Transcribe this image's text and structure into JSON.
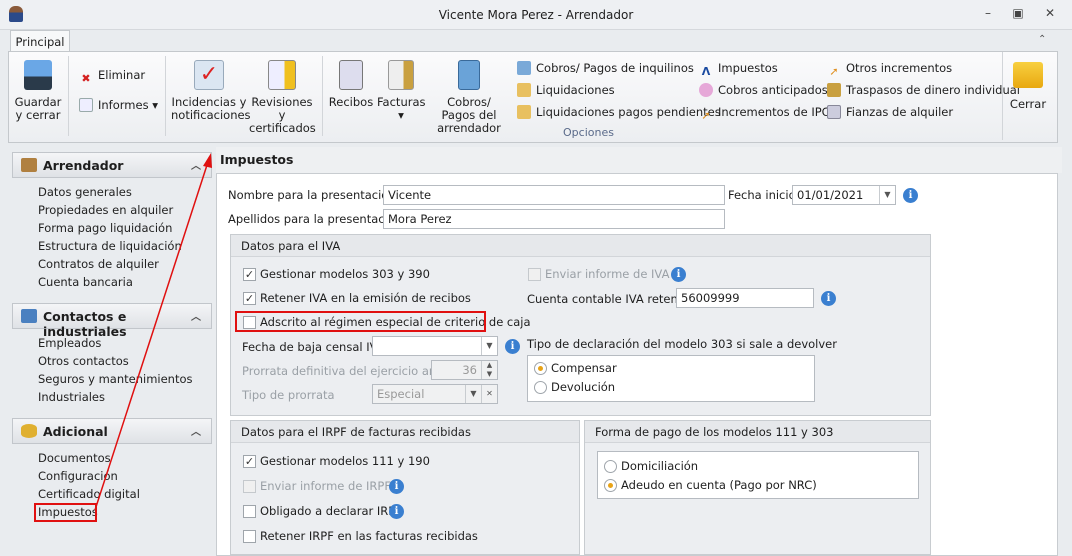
{
  "window": {
    "title": "Vicente Mora Perez - Arrendador",
    "tab": "Principal"
  },
  "ribbon": {
    "guardar": "Guardar y cerrar",
    "eliminar": "Eliminar",
    "informes": "Informes",
    "incidencias": "Incidencias y notificaciones",
    "revisiones": "Revisiones y certificados",
    "recibos": "Recibos",
    "facturas": "Facturas",
    "cobros_pagos_arrendador": "Cobros/ Pagos del arrendador",
    "small": [
      "Cobros/ Pagos de inquilinos",
      "Liquidaciones",
      "Liquidaciones pagos pendientes",
      "Impuestos",
      "Cobros anticipados",
      "Incrementos de IPC",
      "Otros incrementos",
      "Traspasos de dinero individual",
      "Fianzas de alquiler"
    ],
    "group_label": "Opciones",
    "cerrar": "Cerrar"
  },
  "sidebar": {
    "groups": [
      {
        "title": "Arrendador",
        "items": [
          "Datos generales",
          "Propiedades en alquiler",
          "Forma pago liquidación",
          "Estructura de liquidación",
          "Contratos de alquiler",
          "Cuenta bancaria"
        ]
      },
      {
        "title": "Contactos e industriales",
        "items": [
          "Empleados",
          "Otros contactos",
          "Seguros y mantenimientos",
          "Industriales"
        ]
      },
      {
        "title": "Adicional",
        "items": [
          "Documentos",
          "Configuración",
          "Certificado digital",
          "Impuestos"
        ]
      }
    ]
  },
  "main": {
    "title": "Impuestos",
    "nombre_label": "Nombre para la presentación:",
    "nombre": "Vicente",
    "apellidos_label": "Apellidos para la presentación:",
    "apellidos": "Mora Perez",
    "fecha_inicio_label": "Fecha inicio:",
    "fecha_inicio": "01/01/2021",
    "iva": {
      "title": "Datos para el IVA",
      "gestionar": "Gestionar modelos 303 y 390",
      "retener": "Retener IVA en la emisión de recibos",
      "adscrito": "Adscrito al régimen especial de criterio de caja",
      "enviar": "Enviar informe de IVA",
      "cuenta_label": "Cuenta contable IVA retenido:",
      "cuenta": "56009999",
      "fecha_baja_label": "Fecha de baja censal IVA",
      "prorrata_label": "Prorrata definitiva del ejercicio anterior",
      "prorrata": "36",
      "tipo_prorrata_label": "Tipo de prorrata",
      "tipo_prorrata": "Especial",
      "tipo_decl_label": "Tipo de declaración del modelo 303 si sale a devolver",
      "compensar": "Compensar",
      "devolucion": "Devolución"
    },
    "irpf": {
      "title": "Datos para el IRPF de facturas recibidas",
      "gestionar": "Gestionar modelos 111 y 190",
      "enviar": "Enviar informe de IRPF",
      "obligado": "Obligado a declarar IRPF",
      "retener": "Retener IRPF en las facturas recibidas"
    },
    "pago": {
      "title": "Forma de pago de los modelos 111 y 303",
      "domiciliacion": "Domiciliación",
      "adeudo": "Adeudo en cuenta (Pago por NRC)"
    }
  }
}
